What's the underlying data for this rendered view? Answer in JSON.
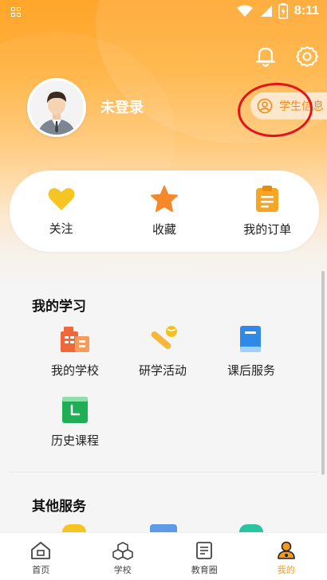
{
  "status_bar": {
    "time": "8:11"
  },
  "profile": {
    "username": "未登录",
    "student_info_label": "学生信息"
  },
  "quick_actions": [
    {
      "label": "关注",
      "icon": "heart-icon"
    },
    {
      "label": "收藏",
      "icon": "star-icon"
    },
    {
      "label": "我的订单",
      "icon": "order-icon"
    }
  ],
  "my_study": {
    "title": "我的学习",
    "items": [
      {
        "label": "我的学校",
        "icon": "school-building-icon"
      },
      {
        "label": "研学活动",
        "icon": "activity-icon"
      },
      {
        "label": "课后服务",
        "icon": "book-icon"
      },
      {
        "label": "历史课程",
        "icon": "history-course-icon"
      }
    ]
  },
  "other_services": {
    "title": "其他服务"
  },
  "tabbar": {
    "tabs": [
      {
        "label": "首页",
        "icon": "home-icon",
        "active": false
      },
      {
        "label": "学校",
        "icon": "school-cubes-icon",
        "active": false
      },
      {
        "label": "教育圈",
        "icon": "edu-circle-icon",
        "active": false
      },
      {
        "label": "我的",
        "icon": "profile-icon",
        "active": true
      }
    ]
  },
  "colors": {
    "accent": "#f39a1e",
    "hero": "#ffa52a",
    "annotation": "#e1141b"
  }
}
